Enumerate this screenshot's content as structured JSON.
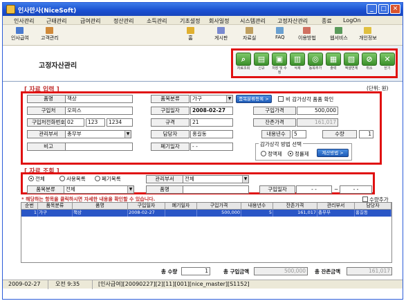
{
  "window": {
    "title": "인사만사(NiceSoft)"
  },
  "menu": [
    "인사관리",
    "근태관리",
    "급여관리",
    "정산관리",
    "소득관리",
    "기초설정",
    "회사일정",
    "시스템관리",
    "고정자산관리",
    "종료",
    "LogOn"
  ],
  "toolbar": [
    "인사급여",
    "고객관리",
    "홈",
    "게시판",
    "자료실",
    "FAQ",
    "이용방법",
    "웹서비스",
    "개인정보"
  ],
  "page": {
    "title": "고정자산관리",
    "unit": "(단위: 원)"
  },
  "actions": [
    "자료조회",
    "신규",
    "저장 및 수정",
    "삭제",
    "동목추가",
    "출력",
    "엑셀연계",
    "취소",
    "닫기"
  ],
  "input_section": {
    "title": "[ 자료 입력 ]",
    "item_name_label": "품명",
    "item_name": "책상",
    "category_label": "품목분류",
    "category": "가구",
    "category_reg_button": "품목분류등록 >",
    "no_depr_label": "비 감가상각 품품 확인",
    "purchaser_label": "구입처",
    "purchaser": "오피스",
    "purchase_date_label": "구입일자",
    "purchase_date": "2008-02-27",
    "purchase_price_label": "구입가격",
    "purchase_price": "500,000",
    "phone_label": "구입처전화번호",
    "phone1": "02",
    "phone2": "123",
    "phone3": "1234",
    "spec_label": "규격",
    "spec": "21",
    "residual_label": "잔존가격",
    "residual": "161,017",
    "dept_label": "관리부서",
    "dept": "총무부",
    "manager_label": "담당자",
    "manager": "홍길동",
    "life_label": "내용년수",
    "life": "5",
    "qty_label": "수량",
    "qty": "1",
    "note_label": "비고",
    "note": "",
    "disposal_label": "폐기일자",
    "disposal": "-  -",
    "depr_method_title": "감가상각 방법 선택",
    "method1": "정액제",
    "method2": "정률제",
    "calc_button": "계산방법 >"
  },
  "search_section": {
    "title": "[ 자료 조회 ]",
    "radio_all": "전체",
    "radio_use": "사용목록",
    "radio_disposed": "폐기목록",
    "dept_label": "관리부서",
    "dept": "전체",
    "category_label": "품목분류",
    "category": "전체",
    "name_label": "품명",
    "name": "",
    "date_label": "구입일자",
    "date_from": "-  -",
    "date_sep": "~",
    "date_to": "-  -"
  },
  "notice": "* 해당하는 항목을 클릭하시면 자세한 내용을 확인할 수 있습니다.",
  "qty_add_label": "수량추가",
  "grid": {
    "headers": [
      "순번",
      "품목분류",
      "품명",
      "구입일자",
      "폐기일자",
      "구입가격",
      "내용년수",
      "잔존가격",
      "관리부서",
      "담당자"
    ],
    "rows": [
      [
        "1",
        "가구",
        "책상",
        "2008-02-27",
        "",
        "500,000",
        "5",
        "161,017",
        "총무부",
        "홍길동"
      ]
    ]
  },
  "totals": {
    "qty_label": "총 수량",
    "qty": "1",
    "price_label": "총 구입금액",
    "price": "500,000",
    "residual_label": "총 잔존금액",
    "residual": "161,017"
  },
  "status": [
    "2009-02-27",
    "오전 9:35",
    "[인사급여][20090227][2][11][001][nice_master][S1152]"
  ]
}
